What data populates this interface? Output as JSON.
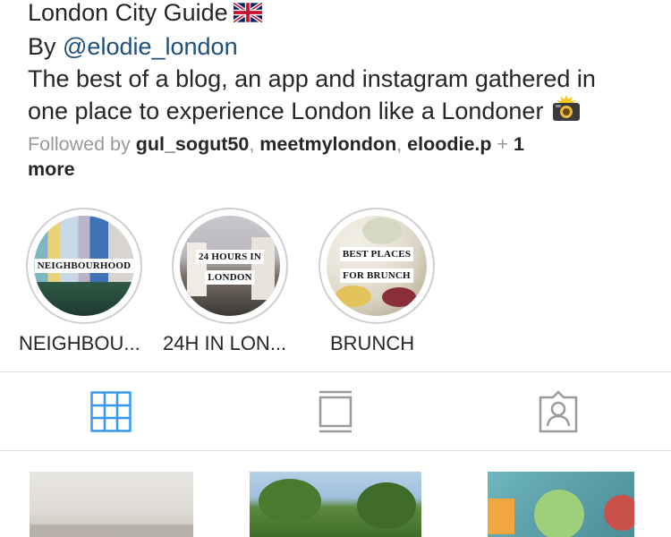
{
  "profile": {
    "title": "London City Guide",
    "by_prefix": "By ",
    "handle": "@elodie_london",
    "bio_line1": "The best of a blog, an app and instagram gathered in",
    "bio_line2": "one place to experience London like a Londoner",
    "followed_prefix": "Followed by ",
    "followers": [
      "gul_sogut50",
      "meetmylondon",
      "eloodie.p"
    ],
    "followed_suffix": " + ",
    "more_count": "1",
    "more_label": "more",
    "flag_icon": "uk-flag-icon",
    "camera_icon": "camera-flash-icon"
  },
  "highlights": [
    {
      "title": "NEIGHBOU...",
      "cover_text": [
        "NEIGHBOURHOOD"
      ]
    },
    {
      "title": "24H IN LON...",
      "cover_text": [
        "24 HOURS IN",
        "LONDON"
      ]
    },
    {
      "title": "BRUNCH",
      "cover_text": [
        "BEST PLACES",
        "FOR BRUNCH"
      ]
    }
  ],
  "tabs": [
    {
      "name": "grid",
      "icon": "grid-icon",
      "active": true,
      "color": "#3897f0"
    },
    {
      "name": "feed",
      "icon": "feed-icon",
      "active": false,
      "color": "#999999"
    },
    {
      "name": "tagged",
      "icon": "tagged-person-icon",
      "active": false,
      "color": "#999999"
    }
  ],
  "colors": {
    "accent": "#3897f0",
    "link": "#1e4f7a",
    "muted": "#999999",
    "divider": "#dbdbdb"
  }
}
